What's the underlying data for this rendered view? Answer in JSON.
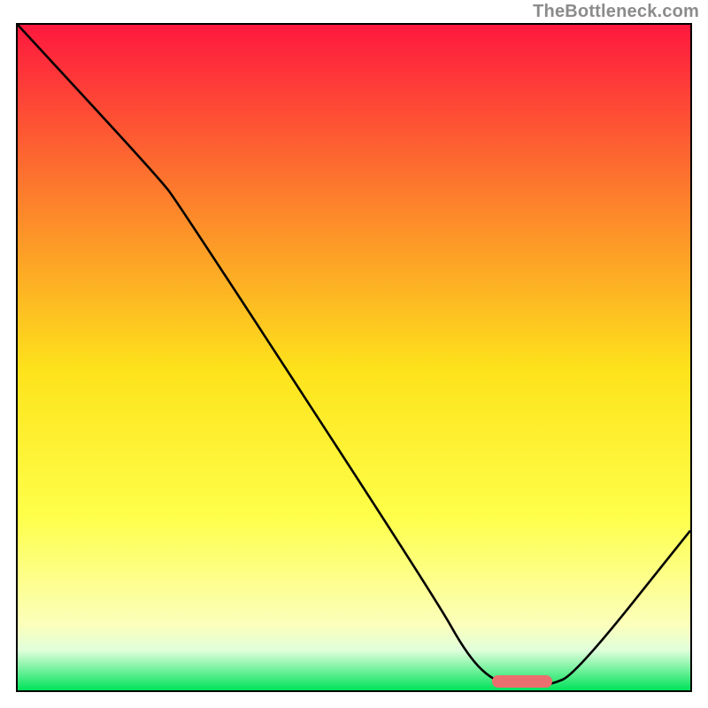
{
  "attribution": "TheBottleneck.com",
  "colors": {
    "gradient_top": "#fe183e",
    "gradient_mid1": "#fd7f2c",
    "gradient_mid2": "#fde31b",
    "gradient_mid3": "#feff4a",
    "gradient_mid4": "#fcffba",
    "gradient_bottom_band_top": "#e0ffdb",
    "gradient_bottom": "#00e35a",
    "curve": "#000000",
    "marker": "#ec6f6f",
    "border": "#000000",
    "attribution_text": "#8b8b8b"
  },
  "chart_data": {
    "type": "line",
    "title": "",
    "xlabel": "",
    "ylabel": "",
    "xlim": [
      0,
      100
    ],
    "ylim": [
      0,
      100
    ],
    "grid": false,
    "curve": [
      {
        "x": 0.0,
        "y": 100.0
      },
      {
        "x": 21.0,
        "y": 77.0
      },
      {
        "x": 24.0,
        "y": 73.0
      },
      {
        "x": 62.0,
        "y": 14.0
      },
      {
        "x": 67.0,
        "y": 5.0
      },
      {
        "x": 71.0,
        "y": 1.2
      },
      {
        "x": 75.0,
        "y": 0.7
      },
      {
        "x": 79.0,
        "y": 0.7
      },
      {
        "x": 83.0,
        "y": 2.5
      },
      {
        "x": 100.0,
        "y": 24.0
      }
    ],
    "marker": {
      "x_start": 70.5,
      "x_end": 79.5,
      "y": 1.3
    }
  }
}
